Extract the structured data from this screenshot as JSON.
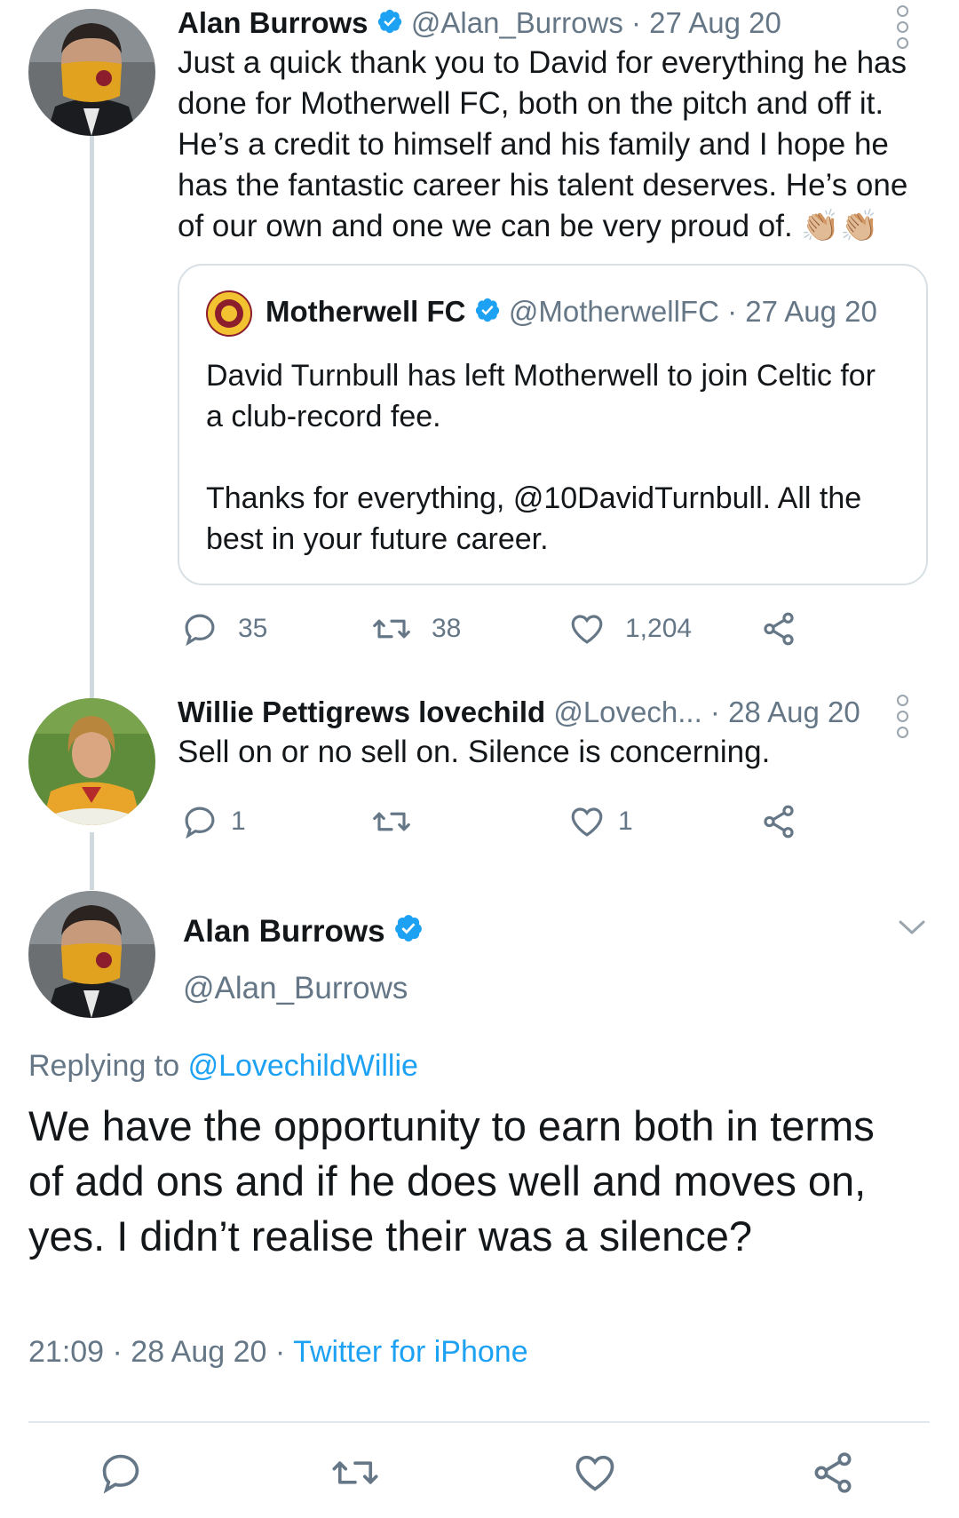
{
  "tweet1": {
    "name": "Alan Burrows",
    "handle": "@Alan_Burrows",
    "date": "· 27 Aug 20",
    "text": "Just a quick thank you to David for everything he has done for Motherwell FC, both on the pitch and off it. He’s a credit to himself and his family and I hope he has the fantastic career his talent deserves. He’s one of our own and one we can be very proud of. 👏🏼👏🏼",
    "quote": {
      "name": "Motherwell FC",
      "handle": "@MotherwellFC",
      "date": "· 27 Aug 20",
      "text1": "David Turnbull has left Motherwell to join Celtic for a club-record fee.",
      "text2": "Thanks for everything, @10DavidTurnbull. All the best in your future career."
    },
    "replies": "35",
    "retweets": "38",
    "likes": "1,204"
  },
  "tweet2": {
    "name": "Willie Pettigrews lovechild",
    "handle": "@Lovech...",
    "date": "· 28 Aug 20",
    "text": "Sell on or no sell on. Silence is concerning.",
    "replies": "1",
    "retweets": "",
    "likes": "1"
  },
  "main_tweet": {
    "name": "Alan Burrows",
    "handle": "@Alan_Burrows",
    "replying_prefix": "Replying to",
    "replying_to": "@LovechildWillie",
    "text": "We have the opportunity to earn both in terms of add ons and if he does well and moves on, yes. I didn’t realise their was a silence?",
    "time": "21:09 · 28 Aug 20 ·",
    "source": "Twitter for iPhone"
  },
  "icons": {
    "reply": "reply-icon",
    "retweet": "retweet-icon",
    "like": "heart-icon",
    "share": "share-icon",
    "verified": "verified-badge-icon",
    "more": "more-options-icon",
    "chevron": "chevron-down-icon"
  },
  "colors": {
    "link": "#1da1f2",
    "secondary": "#657786",
    "text": "#14171a",
    "thread_line": "#cfd9de"
  }
}
